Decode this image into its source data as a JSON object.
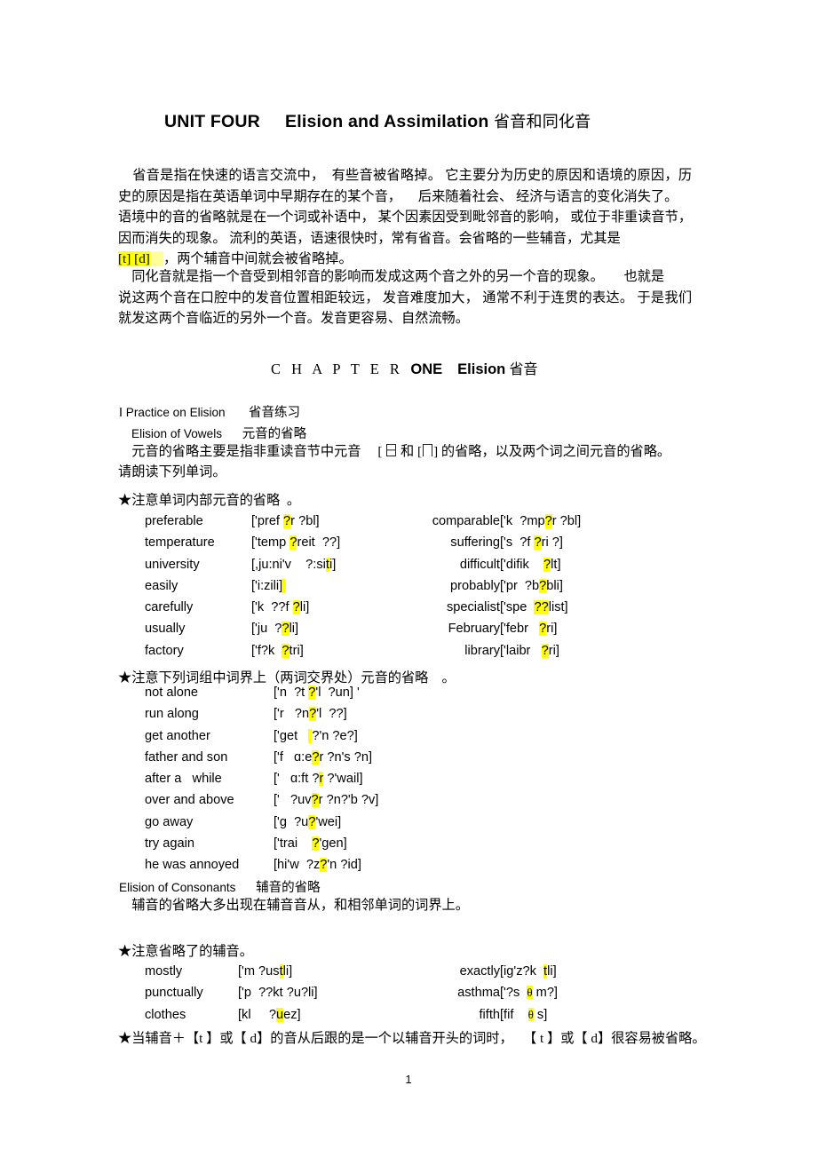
{
  "document": {
    "title_en": "UNIT FOUR     Elision and Assimilation ",
    "title_cn": "省音和同化音",
    "page_number": "1"
  },
  "intro": {
    "paragraph": "    省音是指在快速的语言交流中，  有些音被省略掉。 它主要分为历史的原因和语境的原因，历史的原因是指在英语单词中早期存在的某个音，     后来随着社会、 经济与语言的变化消失了。\n语境中的音的省略就是在一个词或补语中， 某个因素因受到毗邻音的影响， 或位于非重读音节，因而消失的现象。 流利的英语，语速很快时，常有省音。会省略的一些辅音，尤其是",
    "highlight_phonemes": "[t] [d]",
    "paragraph_tail": "，两个辅音中间就会被省略掉。"
  },
  "assimilation": {
    "paragraph": "    同化音就是指一个音受到相邻音的影响而发成这两个音之外的另一个音的现象。      也就是\n说这两个音在口腔中的发音位置相距较远， 发音难度加大， 通常不利于连贯的表达。 于是我们就发这两个音临近的另外一个音。发音更容易、自然流畅。"
  },
  "chapter": {
    "label": "C H A P T E R",
    "number": "ONE",
    "topic_en": "Elision",
    "topic_cn": "省音"
  },
  "sections": {
    "practice_en": "Ⅰ Practice on Elision",
    "practice_cn": "省音练习",
    "vowels_en": "Elision of Vowels",
    "vowels_cn": "元音的省略",
    "vowels_desc_a": "    元音的省略主要是指非重读音节中元音",
    "vowels_desc_b": " 和 [",
    "vowels_desc_c": "] 的省略，以及两个词之间元音的省略。\n请朗读下列单词。",
    "consonants_en": "Elision of Consonants",
    "consonants_cn": "辅音的省略",
    "consonants_desc": "    辅音的省略大多出现在辅音音从，和相邻单词的词界上。"
  },
  "star_notes": {
    "note1": "★注意单词内部元音的省略  。",
    "note2": "★注意下列词组中词界上（两词交界处）元音的省略    。",
    "note3": "★注意省略了的辅音。",
    "note4": "★当辅音＋【t 】或【 d】的音从后跟的是一个以辅音开头的词时，   【 t 】或【 d】很容易被省略。"
  },
  "vowel_words": [
    {
      "left_word": "preferable",
      "left_ipa_a": "['pref ",
      "left_ipa_hl": "?",
      "left_ipa_b": "r ?bl]",
      "right_word": "comparable",
      "right_ipa_a": "['k  ?mp",
      "right_ipa_hl": "?",
      "right_ipa_b": "r ?bl]"
    },
    {
      "left_word": "temperature",
      "left_ipa_a": "['temp ",
      "left_ipa_hl": "?",
      "left_ipa_b": "reit  ??]",
      "right_word": "suffering",
      "right_ipa_a": "['s  ?f ",
      "right_ipa_hl": "?",
      "right_ipa_b": "ri ?]"
    },
    {
      "left_word": "university",
      "left_ipa_a": "[,ju:ni'v    ?:si",
      "left_ipa_hl": "t",
      "left_ipa_b": "i]",
      "right_word": "difficult",
      "right_ipa_a": "['difik    ",
      "right_ipa_hl": "?",
      "right_ipa_b": "lt]"
    },
    {
      "left_word": "easily",
      "left_ipa_a": "['i:zili]",
      "left_ipa_hl": " ",
      "left_ipa_b": "",
      "right_word": "probably",
      "right_ipa_a": "['pr  ?b",
      "right_ipa_hl": "?",
      "right_ipa_b": "bli]"
    },
    {
      "left_word": "carefully",
      "left_ipa_a": "['k  ??f ",
      "left_ipa_hl": "?",
      "left_ipa_b": "li]",
      "right_word": "specialist",
      "right_ipa_a": "['spe  ",
      "right_ipa_hl": "??",
      "right_ipa_b": "list]"
    },
    {
      "left_word": "usually",
      "left_ipa_a": "['ju  ?",
      "left_ipa_hl": "?",
      "left_ipa_b": "li]",
      "right_word": "February",
      "right_ipa_a": "['febr   ",
      "right_ipa_hl": "?",
      "right_ipa_b": "ri]"
    },
    {
      "left_word": "factory",
      "left_ipa_a": "['f?k  ",
      "left_ipa_hl": "?",
      "left_ipa_b": "tri]",
      "right_word": "library",
      "right_ipa_a": "['laibr   ",
      "right_ipa_hl": "?",
      "right_ipa_b": "ri]"
    }
  ],
  "boundary_phrases": [
    {
      "word": "not alone",
      "ipa_a": "['n  ?t ",
      "ipa_hl": "?",
      "ipa_b": "'l  ?un] '"
    },
    {
      "word": "run along",
      "ipa_a": "['r   ?n",
      "ipa_hl": "?",
      "ipa_b": "'l  ??]"
    },
    {
      "word": "get another",
      "ipa_a": "['get   ",
      "ipa_hl": " ",
      "ipa_b": "?'n ?e?]"
    },
    {
      "word": "father and son",
      "ipa_a": "['f   ɑ:e",
      "ipa_hl": "?",
      "ipa_b": "r ?n's ?n]"
    },
    {
      "word": "after a   while",
      "ipa_a": "['   ɑ:ft ?",
      "ipa_hl": "r",
      "ipa_b": " ?'wail]"
    },
    {
      "word": "over and above",
      "ipa_a": "['   ?uv",
      "ipa_hl": "?",
      "ipa_b": "r ?n?'b ?v]"
    },
    {
      "word": "go away",
      "ipa_a": "['g  ?u",
      "ipa_hl": "?",
      "ipa_b": "'wei]"
    },
    {
      "word": "try again",
      "ipa_a": "['trai    ",
      "ipa_hl": "?",
      "ipa_b": "'gen]"
    },
    {
      "word": "he was annoyed",
      "ipa_a": "[hi'w  ?z",
      "ipa_hl": "?",
      "ipa_b": "'n ?id]"
    }
  ],
  "consonant_words": [
    {
      "left_word": "mostly",
      "left_ipa_a": "['m ?us",
      "left_ipa_hl": "t",
      "left_ipa_b": "li]",
      "right_word": "exactly",
      "right_ipa_a": "[ig'z?k  ",
      "right_ipa_hl": "t",
      "right_ipa_b": "li]"
    },
    {
      "left_word": "punctually",
      "left_ipa_a": "['p  ??kt ?u?li]",
      "left_ipa_hl": "",
      "left_ipa_b": "",
      "right_word": "asthma",
      "right_ipa_a": "['?s  ",
      "right_ipa_hl": "θ",
      "right_ipa_b": " m?]"
    },
    {
      "left_word": "clothes",
      "left_ipa_a": "[kl     ?",
      "left_ipa_hl": "u",
      "left_ipa_b": "ez]",
      "right_word": "fifth",
      "right_ipa_a": "[fif    ",
      "right_ipa_hl": "θ",
      "right_ipa_b": " s]"
    }
  ],
  "colors": {
    "highlight": "#FFFF00",
    "text": "#000000",
    "background": "#FFFFFF"
  }
}
